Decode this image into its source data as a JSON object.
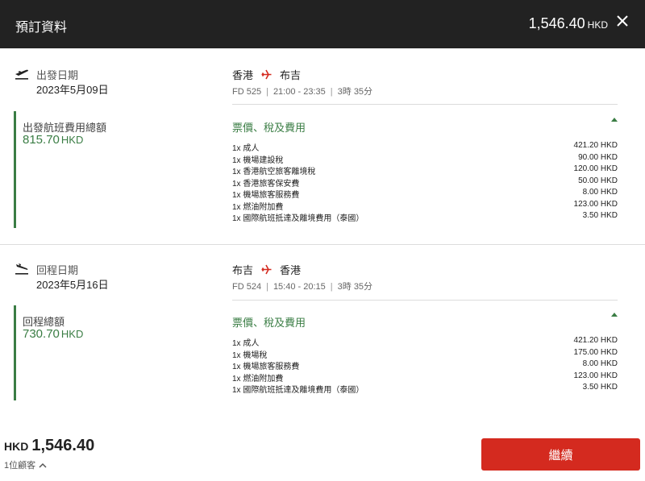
{
  "header": {
    "title": "預訂資料",
    "total_amount": "1,546.40",
    "total_currency": "HKD"
  },
  "outbound": {
    "date_label": "出發日期",
    "date_value": "2023年5月09日",
    "total_label": "出發航班費用總額",
    "total_amount": "815.70",
    "total_currency": "HKD",
    "origin": "香港",
    "destination": "布吉",
    "flight_no": "FD 525",
    "time": "21:00 - 23:35",
    "duration": "3時 35分",
    "fare_title": "票價、稅及費用",
    "items": [
      {
        "name": "1x 成人",
        "amount": "421.20 HKD"
      },
      {
        "name": "1x 機場建設稅",
        "amount": "90.00 HKD"
      },
      {
        "name": "1x 香港航空旅客離境稅",
        "amount": "120.00 HKD"
      },
      {
        "name": "1x 香港旅客保安費",
        "amount": "50.00 HKD"
      },
      {
        "name": "1x 機場旅客服務費",
        "amount": "8.00 HKD"
      },
      {
        "name": "1x 燃油附加費",
        "amount": "123.00 HKD"
      },
      {
        "name": "1x 國際航班抵達及離境費用（泰國）",
        "amount": "3.50 HKD"
      }
    ]
  },
  "return": {
    "date_label": "回程日期",
    "date_value": "2023年5月16日",
    "total_label": "回程總額",
    "total_amount": "730.70",
    "total_currency": "HKD",
    "origin": "布吉",
    "destination": "香港",
    "flight_no": "FD 524",
    "time": "15:40 - 20:15",
    "duration": "3時 35分",
    "fare_title": "票價、稅及費用",
    "items": [
      {
        "name": "1x 成人",
        "amount": "421.20 HKD"
      },
      {
        "name": "1x 機場稅",
        "amount": "175.00 HKD"
      },
      {
        "name": "1x 機場旅客服務費",
        "amount": "8.00 HKD"
      },
      {
        "name": "1x 燃油附加費",
        "amount": "123.00 HKD"
      },
      {
        "name": "1x 國際航班抵達及離境費用（泰國）",
        "amount": "3.50 HKD"
      }
    ]
  },
  "footer": {
    "currency": "HKD",
    "amount": "1,546.40",
    "passengers": "1位顧客",
    "continue_label": "繼續"
  },
  "icons": {
    "close": "close-icon",
    "takeoff": "plane-takeoff-icon",
    "landing": "plane-landing-icon",
    "route_arrow": "plane-arrow-icon",
    "chevron": "chevron-up-icon"
  },
  "colors": {
    "header_bg": "#222222",
    "accent_green": "#3a7d44",
    "accent_red": "#d42a1f"
  }
}
